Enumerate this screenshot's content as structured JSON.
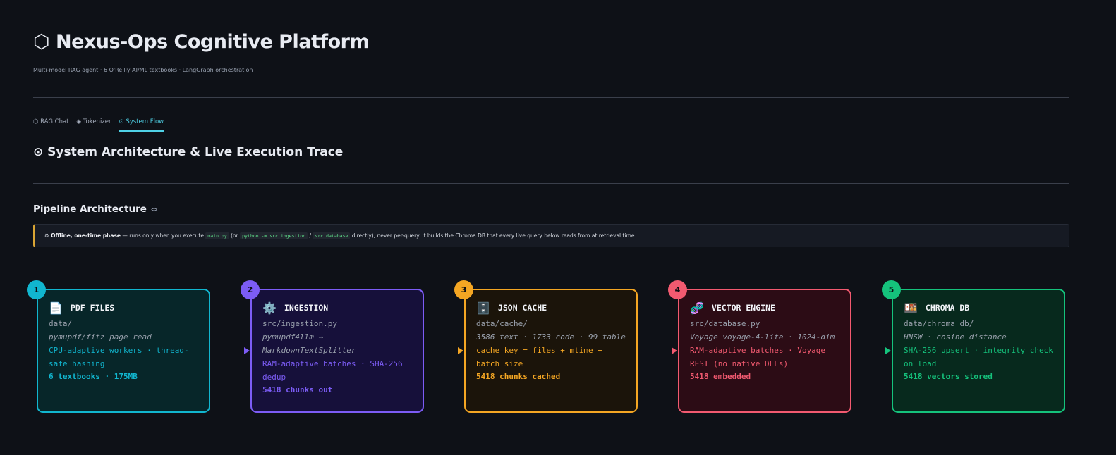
{
  "header": {
    "title": "⬡ Nexus-Ops Cognitive Platform",
    "subtitle": "Multi-model RAG agent · 6 O'Reilly AI/ML textbooks · LangGraph orchestration"
  },
  "tabs": [
    {
      "label": "⬡ RAG Chat",
      "active": false
    },
    {
      "label": "◈ Tokenizer",
      "active": false
    },
    {
      "label": "⊙ System Flow",
      "active": true
    }
  ],
  "section_title": "⊙ System Architecture & Live Execution Trace",
  "pipeline": {
    "heading": "Pipeline Architecture",
    "link_icon": "⇔",
    "notice": {
      "icon": "⚙",
      "bold": "Offline, one-time phase",
      "t1": " — runs only when you execute ",
      "code1": "main.py",
      "t2": " (or ",
      "code2": "python -m src.ingestion",
      "t3": " / ",
      "code3": "src.database",
      "t4": " directly), never per-query. It builds the Chroma DB that every live query below reads from at retrieval time."
    },
    "stages": [
      {
        "num": "1",
        "icon": "📄",
        "icon_name": "document-icon",
        "title": "PDF FILES",
        "path": "data/",
        "tool": "pymupdf/fitz page read",
        "detail": "CPU-adaptive workers · thread-safe hashing",
        "stat": "6 textbooks · 175MB",
        "color": "#11b6cf",
        "bg": "#072629"
      },
      {
        "num": "2",
        "icon": "⚙️",
        "icon_name": "gear-icon",
        "title": "INGESTION",
        "path": "src/ingestion.py",
        "tool": "pymupdf4llm → MarkdownTextSplitter",
        "detail": "RAM-adaptive batches · SHA-256 dedup",
        "stat": "5418 chunks out",
        "color": "#7c5cf5",
        "bg": "#16103a"
      },
      {
        "num": "3",
        "icon": "🗄️",
        "icon_name": "cabinet-icon",
        "title": "JSON CACHE",
        "path": "data/cache/",
        "tool": "3586 text · 1733 code · 99 table",
        "detail": "cache key = files + mtime + batch size",
        "stat": "5418 chunks cached",
        "color": "#f4a623",
        "bg": "#1b140a"
      },
      {
        "num": "4",
        "icon": "🧬",
        "icon_name": "dna-icon",
        "title": "VECTOR ENGINE",
        "path": "src/database.py",
        "tool": "Voyage voyage-4-lite · 1024-dim",
        "detail": "RAM-adaptive batches · Voyage REST (no native DLLs)",
        "stat": "5418 embedded",
        "color": "#f25a70",
        "bg": "#2c0c15"
      },
      {
        "num": "5",
        "icon": "🍱",
        "icon_name": "database-icon",
        "title": "CHROMA DB",
        "path": "data/chroma_db/",
        "tool": "HNSW · cosine distance",
        "detail": "SHA-256 upsert · integrity check on load",
        "stat": "5418 vectors stored",
        "color": "#15c27c",
        "bg": "#07291d"
      }
    ]
  }
}
